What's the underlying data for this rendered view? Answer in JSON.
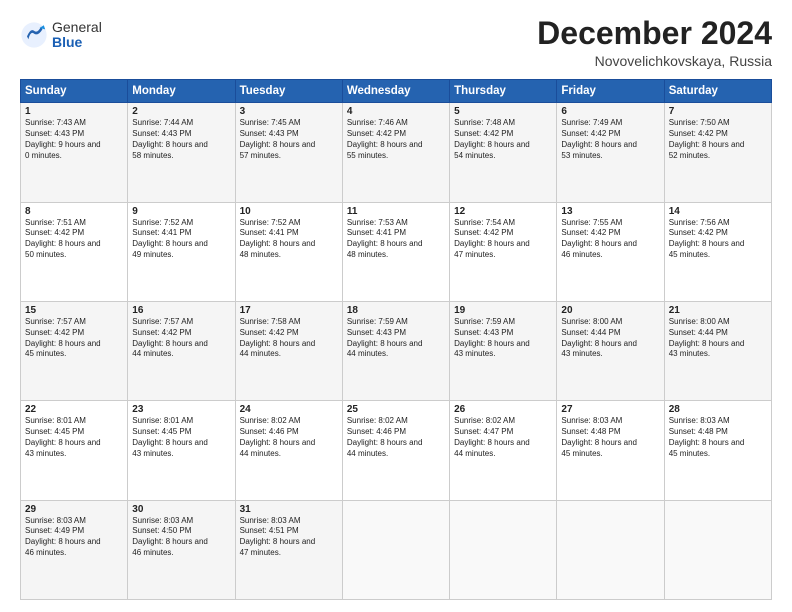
{
  "logo": {
    "general": "General",
    "blue": "Blue"
  },
  "title": "December 2024",
  "subtitle": "Novovelichkovskaya, Russia",
  "days_header": [
    "Sunday",
    "Monday",
    "Tuesday",
    "Wednesday",
    "Thursday",
    "Friday",
    "Saturday"
  ],
  "weeks": [
    [
      {
        "num": "1",
        "sunrise": "7:43 AM",
        "sunset": "4:43 PM",
        "daylight": "9 hours and 0 minutes."
      },
      {
        "num": "2",
        "sunrise": "7:44 AM",
        "sunset": "4:43 PM",
        "daylight": "8 hours and 58 minutes."
      },
      {
        "num": "3",
        "sunrise": "7:45 AM",
        "sunset": "4:43 PM",
        "daylight": "8 hours and 57 minutes."
      },
      {
        "num": "4",
        "sunrise": "7:46 AM",
        "sunset": "4:42 PM",
        "daylight": "8 hours and 55 minutes."
      },
      {
        "num": "5",
        "sunrise": "7:48 AM",
        "sunset": "4:42 PM",
        "daylight": "8 hours and 54 minutes."
      },
      {
        "num": "6",
        "sunrise": "7:49 AM",
        "sunset": "4:42 PM",
        "daylight": "8 hours and 53 minutes."
      },
      {
        "num": "7",
        "sunrise": "7:50 AM",
        "sunset": "4:42 PM",
        "daylight": "8 hours and 52 minutes."
      }
    ],
    [
      {
        "num": "8",
        "sunrise": "7:51 AM",
        "sunset": "4:42 PM",
        "daylight": "8 hours and 50 minutes."
      },
      {
        "num": "9",
        "sunrise": "7:52 AM",
        "sunset": "4:41 PM",
        "daylight": "8 hours and 49 minutes."
      },
      {
        "num": "10",
        "sunrise": "7:52 AM",
        "sunset": "4:41 PM",
        "daylight": "8 hours and 48 minutes."
      },
      {
        "num": "11",
        "sunrise": "7:53 AM",
        "sunset": "4:41 PM",
        "daylight": "8 hours and 48 minutes."
      },
      {
        "num": "12",
        "sunrise": "7:54 AM",
        "sunset": "4:42 PM",
        "daylight": "8 hours and 47 minutes."
      },
      {
        "num": "13",
        "sunrise": "7:55 AM",
        "sunset": "4:42 PM",
        "daylight": "8 hours and 46 minutes."
      },
      {
        "num": "14",
        "sunrise": "7:56 AM",
        "sunset": "4:42 PM",
        "daylight": "8 hours and 45 minutes."
      }
    ],
    [
      {
        "num": "15",
        "sunrise": "7:57 AM",
        "sunset": "4:42 PM",
        "daylight": "8 hours and 45 minutes."
      },
      {
        "num": "16",
        "sunrise": "7:57 AM",
        "sunset": "4:42 PM",
        "daylight": "8 hours and 44 minutes."
      },
      {
        "num": "17",
        "sunrise": "7:58 AM",
        "sunset": "4:42 PM",
        "daylight": "8 hours and 44 minutes."
      },
      {
        "num": "18",
        "sunrise": "7:59 AM",
        "sunset": "4:43 PM",
        "daylight": "8 hours and 44 minutes."
      },
      {
        "num": "19",
        "sunrise": "7:59 AM",
        "sunset": "4:43 PM",
        "daylight": "8 hours and 43 minutes."
      },
      {
        "num": "20",
        "sunrise": "8:00 AM",
        "sunset": "4:44 PM",
        "daylight": "8 hours and 43 minutes."
      },
      {
        "num": "21",
        "sunrise": "8:00 AM",
        "sunset": "4:44 PM",
        "daylight": "8 hours and 43 minutes."
      }
    ],
    [
      {
        "num": "22",
        "sunrise": "8:01 AM",
        "sunset": "4:45 PM",
        "daylight": "8 hours and 43 minutes."
      },
      {
        "num": "23",
        "sunrise": "8:01 AM",
        "sunset": "4:45 PM",
        "daylight": "8 hours and 43 minutes."
      },
      {
        "num": "24",
        "sunrise": "8:02 AM",
        "sunset": "4:46 PM",
        "daylight": "8 hours and 44 minutes."
      },
      {
        "num": "25",
        "sunrise": "8:02 AM",
        "sunset": "4:46 PM",
        "daylight": "8 hours and 44 minutes."
      },
      {
        "num": "26",
        "sunrise": "8:02 AM",
        "sunset": "4:47 PM",
        "daylight": "8 hours and 44 minutes."
      },
      {
        "num": "27",
        "sunrise": "8:03 AM",
        "sunset": "4:48 PM",
        "daylight": "8 hours and 45 minutes."
      },
      {
        "num": "28",
        "sunrise": "8:03 AM",
        "sunset": "4:48 PM",
        "daylight": "8 hours and 45 minutes."
      }
    ],
    [
      {
        "num": "29",
        "sunrise": "8:03 AM",
        "sunset": "4:49 PM",
        "daylight": "8 hours and 46 minutes."
      },
      {
        "num": "30",
        "sunrise": "8:03 AM",
        "sunset": "4:50 PM",
        "daylight": "8 hours and 46 minutes."
      },
      {
        "num": "31",
        "sunrise": "8:03 AM",
        "sunset": "4:51 PM",
        "daylight": "8 hours and 47 minutes."
      },
      null,
      null,
      null,
      null
    ]
  ]
}
